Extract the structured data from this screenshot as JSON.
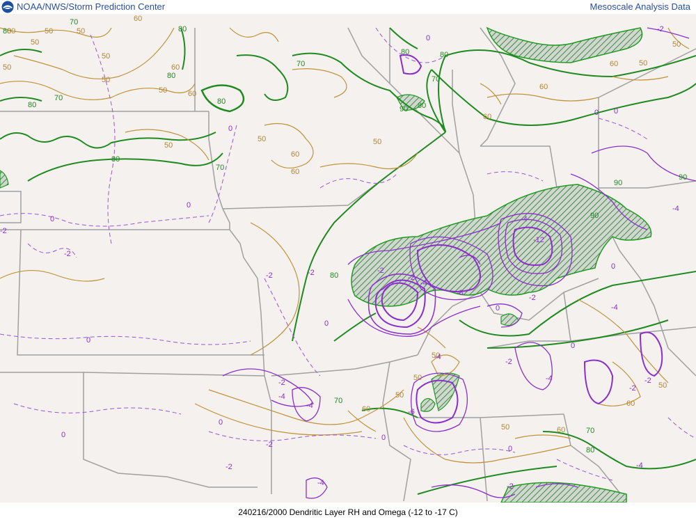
{
  "header": {
    "left_title": "NOAA/NWS/Storm Prediction Center",
    "right_title": "Mesoscale Analysis Data",
    "logo_icon": "noaa-logo-icon"
  },
  "footer": {
    "caption": "240216/2000 Dendritic Layer RH and Omega (-12 to -17 C)"
  },
  "colors": {
    "background": "#f4f1ee",
    "state_borders": "#a0a0a0",
    "rh_contour": "#1f8a1f",
    "rh_mid_contour": "#c0923a",
    "omega_contour": "#8a2fc9",
    "rh_hatch": "#1f8a1f",
    "title_text": "#2a4fa0"
  },
  "contour_labels": {
    "rh": [
      "80",
      "70",
      "80",
      "70",
      "80",
      "70",
      "80",
      "80",
      "90",
      "90",
      "70",
      "80",
      "90",
      "80",
      "70",
      "80",
      "90",
      "70",
      "80",
      "70",
      "80",
      "80"
    ],
    "mid_rh": [
      "80",
      "50",
      "50",
      "60",
      "50",
      "50",
      "50",
      "50",
      "50",
      "60",
      "50",
      "60",
      "50",
      "60",
      "60",
      "50",
      "60",
      "60",
      "50",
      "50",
      "60",
      "50",
      "50",
      "50",
      "60",
      "50",
      "60",
      "60",
      "50"
    ],
    "omega": [
      "0",
      "-2",
      "0",
      "-2",
      "0",
      "0",
      "-2",
      "-2",
      "0",
      "-2",
      "-2",
      "-4",
      "-8",
      "-4",
      "-12",
      "-6",
      "-4",
      "-2",
      "-2",
      "0",
      "-4",
      "-4",
      "0",
      "-2",
      "0",
      "-4",
      "-2",
      "-4",
      "-4",
      "0",
      "-2",
      "0",
      "0",
      "-2",
      "-4",
      "0",
      "-4",
      "0",
      "-2",
      "-2",
      "0",
      "-2",
      "0"
    ]
  }
}
